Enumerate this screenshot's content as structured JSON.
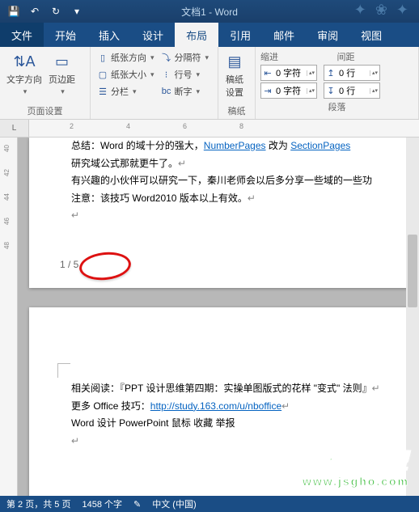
{
  "titlebar": {
    "doc_title": "文档1 - Word"
  },
  "tabs": {
    "file": "文件",
    "items": [
      "开始",
      "插入",
      "设计",
      "布局",
      "引用",
      "邮件",
      "审阅",
      "视图"
    ],
    "active_index": 3
  },
  "ribbon": {
    "group1": {
      "text_direction": "文字方向",
      "margins": "页边距",
      "label": "页面设置"
    },
    "group2": {
      "orientation": "纸张方向",
      "size": "纸张大小",
      "columns": "分栏",
      "breaks": "分隔符",
      "line_numbers": "行号",
      "hyphenation": "断字"
    },
    "group3": {
      "draft_setup": "稿纸\n设置",
      "label": "稿纸"
    },
    "group4": {
      "indent_label": "缩进",
      "spacing_label": "间距",
      "indent_left": "0 字符",
      "indent_right": "0 字符",
      "spacing_before": "0 行",
      "spacing_after": "0 行",
      "label": "段落"
    }
  },
  "ruler": {
    "corner": "L",
    "marks": [
      "2",
      "4",
      "6",
      "8"
    ]
  },
  "vruler_marks": [
    "40",
    "42",
    "44",
    "46",
    "48"
  ],
  "page1": {
    "line1_a": "总结：Word 的域十分的强大，",
    "line1_b": "NumberPages",
    "line1_c": " 改为 ",
    "line1_d": "SectionPages",
    "line2": "研究域公式那就更牛了。",
    "line3": "有兴趣的小伙伴可以研究一下，秦川老师会以后多分享一些域的一些功",
    "line4": "注意：该技巧 Word2010 版本以上有效。",
    "page_num": "1 / 5"
  },
  "page2": {
    "line1": "相关阅读：『PPT 设计思维第四期：实操单图版式的花样 \"变式\" 法则』",
    "line2_a": "更多 Office 技巧：",
    "line2_b": "http://study.163.com/u/nboffice",
    "line3": "  Word  设计  PowerPoint  鼠标  收藏   举报"
  },
  "statusbar": {
    "page": "第 2 页，共 5 页",
    "words": "1458 个字",
    "lang": "中文 (中国)"
  },
  "watermark": {
    "line1": "技术员联盟",
    "line2": "www.jsgho.com"
  }
}
